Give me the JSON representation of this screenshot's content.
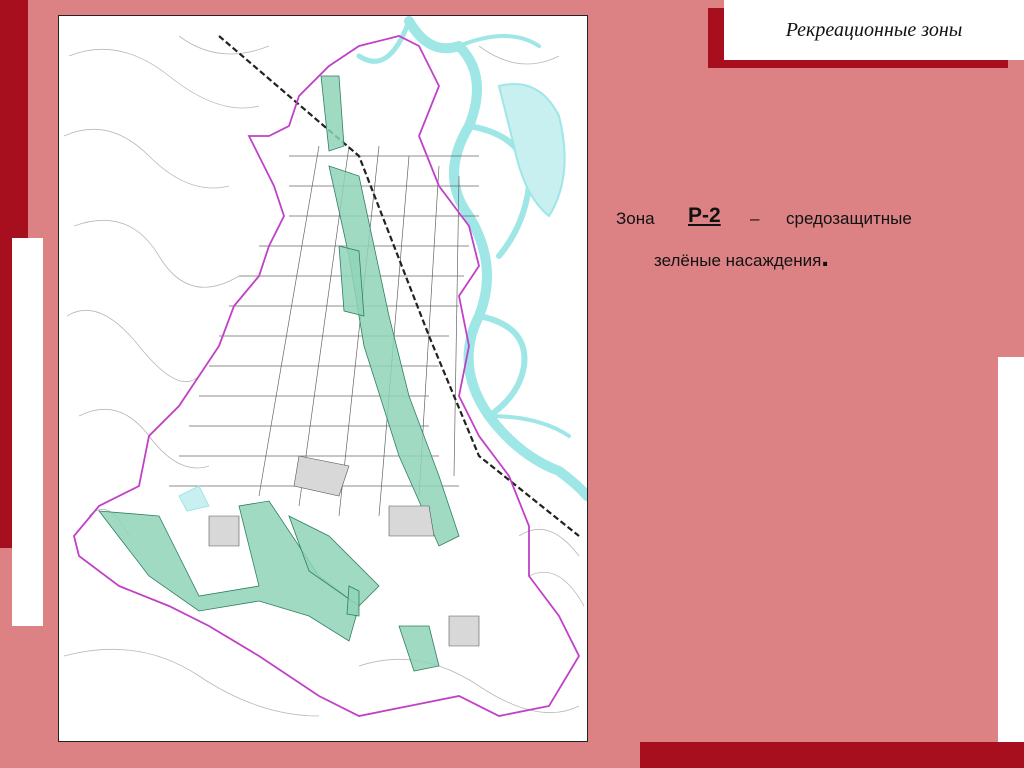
{
  "slide": {
    "title": "Рекреационные зоны"
  },
  "caption": {
    "zone_word": "Зона",
    "zone_code": "Р-2",
    "dash": "–",
    "line1": "средозащитные",
    "line2": "зелёные насаждения",
    "end_mark": "."
  },
  "colors": {
    "background": "#dc8285",
    "accent_dark": "#a80f1e",
    "river": "#9fe6e6",
    "green_zone": "#8fd3b8",
    "boundary": "#c040c8"
  }
}
